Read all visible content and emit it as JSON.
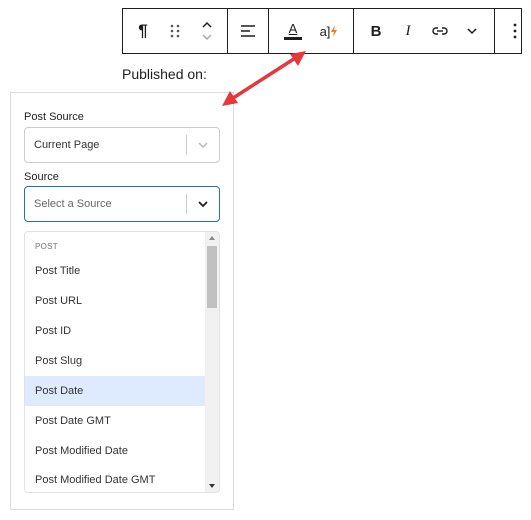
{
  "toolbar": {
    "groups": [
      {
        "buttons": [
          {
            "icon": "paragraph-icon",
            "label": "¶"
          },
          {
            "icon": "drag-handle-icon"
          },
          {
            "icon": "move-up-down-icon"
          }
        ]
      },
      {
        "buttons": [
          {
            "icon": "align-left-icon"
          }
        ]
      },
      {
        "buttons": [
          {
            "icon": "text-color-icon",
            "label": "A"
          },
          {
            "icon": "dynamic-data-icon",
            "label": "a]"
          }
        ]
      },
      {
        "buttons": [
          {
            "icon": "bold-icon",
            "label": "B"
          },
          {
            "icon": "italic-icon",
            "label": "I"
          },
          {
            "icon": "link-icon"
          },
          {
            "icon": "chevron-down-icon"
          }
        ]
      },
      {
        "buttons": [
          {
            "icon": "more-options-icon"
          }
        ]
      }
    ]
  },
  "content": {
    "published_label": "Published on:"
  },
  "panel": {
    "post_source": {
      "label": "Post Source",
      "value": "Current Page"
    },
    "source": {
      "label": "Source",
      "placeholder": "Select a Source"
    },
    "menu": {
      "group_label": "POST",
      "items": [
        "Post Title",
        "Post URL",
        "Post ID",
        "Post Slug",
        "Post Date",
        "Post Date GMT",
        "Post Modified Date",
        "Post Modified Date GMT"
      ],
      "highlighted": "Post Date"
    }
  },
  "colors": {
    "arrow": "#e5383b",
    "focus": "#2271b1",
    "highlight": "#deebff",
    "accent_bolt": "#f0821e"
  }
}
